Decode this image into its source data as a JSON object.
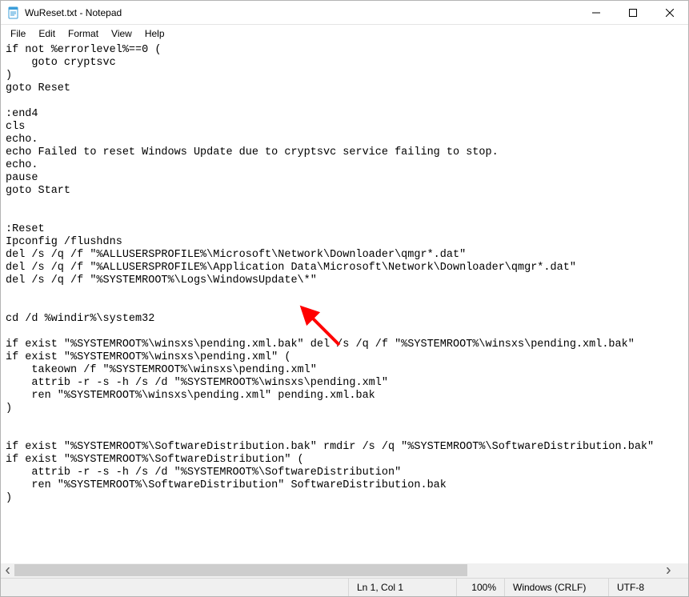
{
  "window": {
    "title": "WuReset.txt - Notepad"
  },
  "menu": {
    "file": "File",
    "edit": "Edit",
    "format": "Format",
    "view": "View",
    "help": "Help"
  },
  "editor": {
    "content": "if not %errorlevel%==0 (\n    goto cryptsvc\n)\ngoto Reset\n\n:end4\ncls\necho.\necho Failed to reset Windows Update due to cryptsvc service failing to stop.\necho.\npause\ngoto Start\n\n\n:Reset\nIpconfig /flushdns\ndel /s /q /f \"%ALLUSERSPROFILE%\\Microsoft\\Network\\Downloader\\qmgr*.dat\"\ndel /s /q /f \"%ALLUSERSPROFILE%\\Application Data\\Microsoft\\Network\\Downloader\\qmgr*.dat\"\ndel /s /q /f \"%SYSTEMROOT%\\Logs\\WindowsUpdate\\*\"\n\n\ncd /d %windir%\\system32\n\nif exist \"%SYSTEMROOT%\\winsxs\\pending.xml.bak\" del /s /q /f \"%SYSTEMROOT%\\winsxs\\pending.xml.bak\"\nif exist \"%SYSTEMROOT%\\winsxs\\pending.xml\" (\n    takeown /f \"%SYSTEMROOT%\\winsxs\\pending.xml\"\n    attrib -r -s -h /s /d \"%SYSTEMROOT%\\winsxs\\pending.xml\"\n    ren \"%SYSTEMROOT%\\winsxs\\pending.xml\" pending.xml.bak\n)\n\n\nif exist \"%SYSTEMROOT%\\SoftwareDistribution.bak\" rmdir /s /q \"%SYSTEMROOT%\\SoftwareDistribution.bak\"\nif exist \"%SYSTEMROOT%\\SoftwareDistribution\" (\n    attrib -r -s -h /s /d \"%SYSTEMROOT%\\SoftwareDistribution\"\n    ren \"%SYSTEMROOT%\\SoftwareDistribution\" SoftwareDistribution.bak\n)\n\n"
  },
  "status": {
    "position": "Ln 1, Col 1",
    "zoom": "100%",
    "eol": "Windows (CRLF)",
    "encoding": "UTF-8"
  },
  "annotation": {
    "arrow_color": "#ff0000"
  }
}
